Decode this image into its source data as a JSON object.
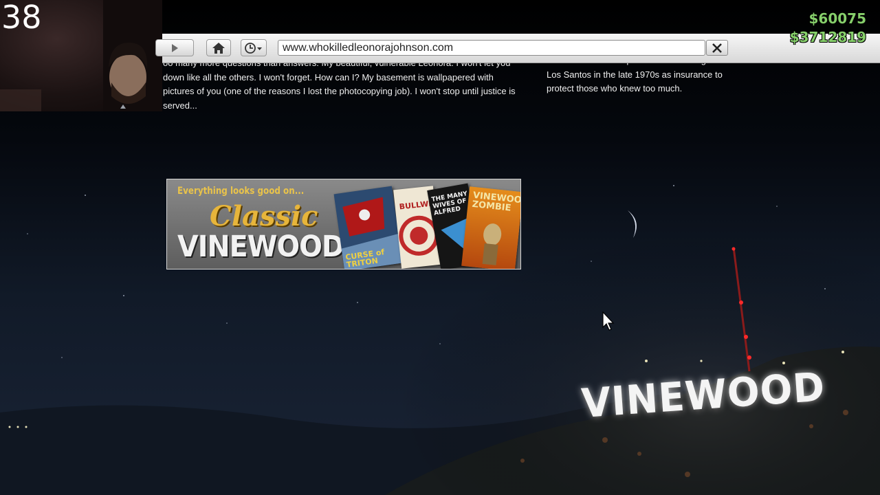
{
  "hud": {
    "counter": "38",
    "cash": "$60075",
    "bank": "$3712819"
  },
  "browser": {
    "url": "www.whokilledleonorajohnson.com",
    "left_text": "oo many more questions than answers. My beautiful, vulnerable Leonora. I won't let you down like all the others. I won't forget. How can I? My basement is wallpapered with pictures of you (one of the reasons I lost the photocopying job). I won't stop until justice is served...",
    "right_text": "that had to be torn up and hidden throughout Los Santos in the late 1970s as insurance to protect those who knew too much."
  },
  "ad": {
    "tagline": "Everything looks good on...",
    "brand_line1": "Classic",
    "brand_line2": "VINEWOOD",
    "books": [
      {
        "title": "CURSE of TRITON"
      },
      {
        "title": "BULLWHIP"
      },
      {
        "title": "THE MANY WIVES OF ALFRED"
      },
      {
        "title": "VINEWOOD ZOMBIE"
      }
    ]
  },
  "scene": {
    "sign_text": "VINEWOOD"
  },
  "colors": {
    "money": "#86cf6b",
    "toolbar": "#e4e4e4",
    "ad_gold": "#e7b53b"
  }
}
